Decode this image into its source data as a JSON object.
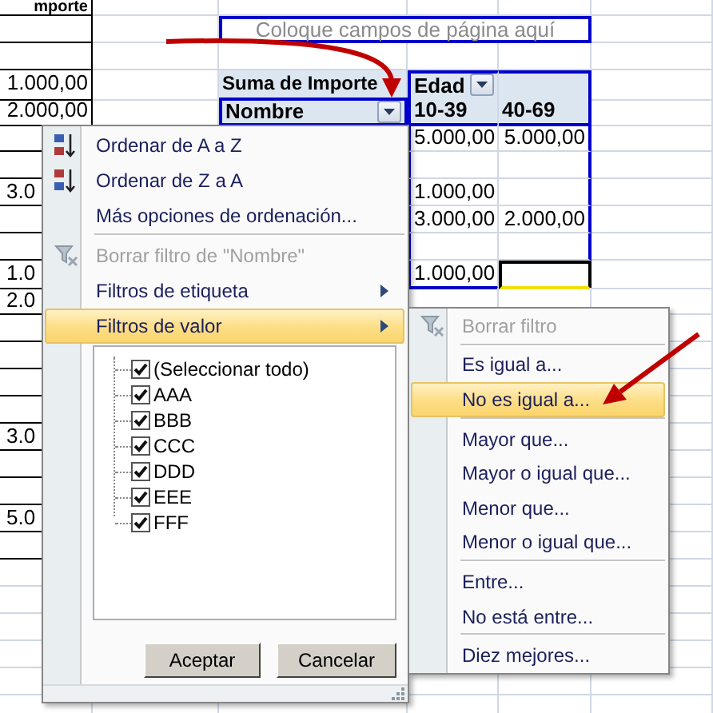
{
  "sheet_rows": [
    {
      "kind": "column_header",
      "a": {
        "text": "mporte",
        "selected": false
      }
    },
    {
      "kind": "page_field",
      "c": {
        "text": "Coloque campos de página aquí",
        "selected": false
      }
    },
    {
      "kind": "plain"
    },
    {
      "kind": "pivot_header",
      "a": {
        "text": "1.000,00",
        "selected": false
      },
      "c": {
        "text": "Suma de Importe",
        "selected": false
      },
      "d": {
        "text": "Edad",
        "selected": false
      }
    },
    {
      "kind": "pivot_labels",
      "a": {
        "text": "2.000,00",
        "selected": false
      },
      "c": {
        "text": "Nombre",
        "selected": false
      },
      "d": {
        "text": "10-39",
        "selected": false
      },
      "e": {
        "text": "40-69",
        "selected": false
      }
    },
    {
      "kind": "pivot_data",
      "d": {
        "text": "5.000,00",
        "selected": false
      },
      "e": {
        "text": "5.000,00",
        "selected": false
      }
    },
    {
      "kind": "pivot_data"
    },
    {
      "kind": "pivot_data",
      "a": {
        "text": "3.0",
        "selected": false
      },
      "d": {
        "text": "1.000,00",
        "selected": false
      }
    },
    {
      "kind": "pivot_data",
      "d": {
        "text": "3.000,00",
        "selected": false
      },
      "e": {
        "text": "2.000,00",
        "selected": false
      }
    },
    {
      "kind": "pivot_data"
    },
    {
      "kind": "pivot_data_last",
      "a": {
        "text": "1.0",
        "selected": false
      },
      "d": {
        "text": "1.000,00",
        "selected": false
      },
      "e": {
        "selected": true
      }
    },
    {
      "kind": "plain",
      "a": {
        "text": "2.0",
        "selected": false
      }
    },
    {
      "kind": "plain"
    },
    {
      "kind": "plain"
    },
    {
      "kind": "plain"
    },
    {
      "kind": "plain"
    },
    {
      "kind": "plain",
      "a": {
        "text": "3.0",
        "selected": false
      }
    },
    {
      "kind": "plain"
    },
    {
      "kind": "plain"
    },
    {
      "kind": "plain",
      "a": {
        "text": "5.0",
        "selected": false
      }
    },
    {
      "kind": "plain"
    },
    {
      "kind": "blank"
    },
    {
      "kind": "blank"
    },
    {
      "kind": "blank"
    },
    {
      "kind": "blank"
    },
    {
      "kind": "blank"
    },
    {
      "kind": "blank"
    }
  ],
  "sort_filter_menu": {
    "items": [
      {
        "kind": "sort_asc",
        "text": "Ordenar de A a Z",
        "disabled": false,
        "selected": false
      },
      {
        "kind": "sort_desc",
        "text": "Ordenar de Z a A",
        "disabled": false,
        "selected": false
      },
      {
        "kind": "item",
        "text": "Más opciones de ordenación...",
        "disabled": false,
        "selected": false
      },
      {
        "kind": "separator"
      },
      {
        "kind": "clear_filter",
        "text": "Borrar filtro de \"Nombre\"",
        "disabled": true,
        "selected": false
      },
      {
        "kind": "submenu",
        "text": "Filtros de etiqueta",
        "disabled": false,
        "selected": false
      },
      {
        "kind": "submenu",
        "text": "Filtros de valor",
        "disabled": false,
        "selected": true
      }
    ],
    "checklist": [
      {
        "label": "(Seleccionar todo)",
        "checked": true
      },
      {
        "label": "AAA",
        "checked": true
      },
      {
        "label": "BBB",
        "checked": true
      },
      {
        "label": "CCC",
        "checked": true
      },
      {
        "label": "DDD",
        "checked": true
      },
      {
        "label": "EEE",
        "checked": true
      },
      {
        "label": "FFF",
        "checked": true
      }
    ],
    "buttons": [
      "Aceptar",
      "Cancelar"
    ]
  },
  "value_filter_submenu": {
    "items": [
      {
        "kind": "clear_filter",
        "text": "Borrar filtro",
        "disabled": true,
        "selected": false
      },
      {
        "kind": "separator"
      },
      {
        "kind": "item",
        "text": "Es igual a...",
        "disabled": false,
        "selected": false
      },
      {
        "kind": "item",
        "text": "No es igual a...",
        "disabled": false,
        "selected": true
      },
      {
        "kind": "separator"
      },
      {
        "kind": "item",
        "text": "Mayor que...",
        "disabled": false,
        "selected": false
      },
      {
        "kind": "item",
        "text": "Mayor o igual que...",
        "disabled": false,
        "selected": false
      },
      {
        "kind": "item",
        "text": "Menor que...",
        "disabled": false,
        "selected": false
      },
      {
        "kind": "item",
        "text": "Menor o igual que...",
        "disabled": false,
        "selected": false
      },
      {
        "kind": "separator"
      },
      {
        "kind": "item",
        "text": "Entre...",
        "disabled": false,
        "selected": false
      },
      {
        "kind": "item",
        "text": "No está entre...",
        "disabled": false,
        "selected": false
      },
      {
        "kind": "separator"
      },
      {
        "kind": "item",
        "text": "Diez mejores...",
        "disabled": false,
        "selected": false
      }
    ]
  }
}
